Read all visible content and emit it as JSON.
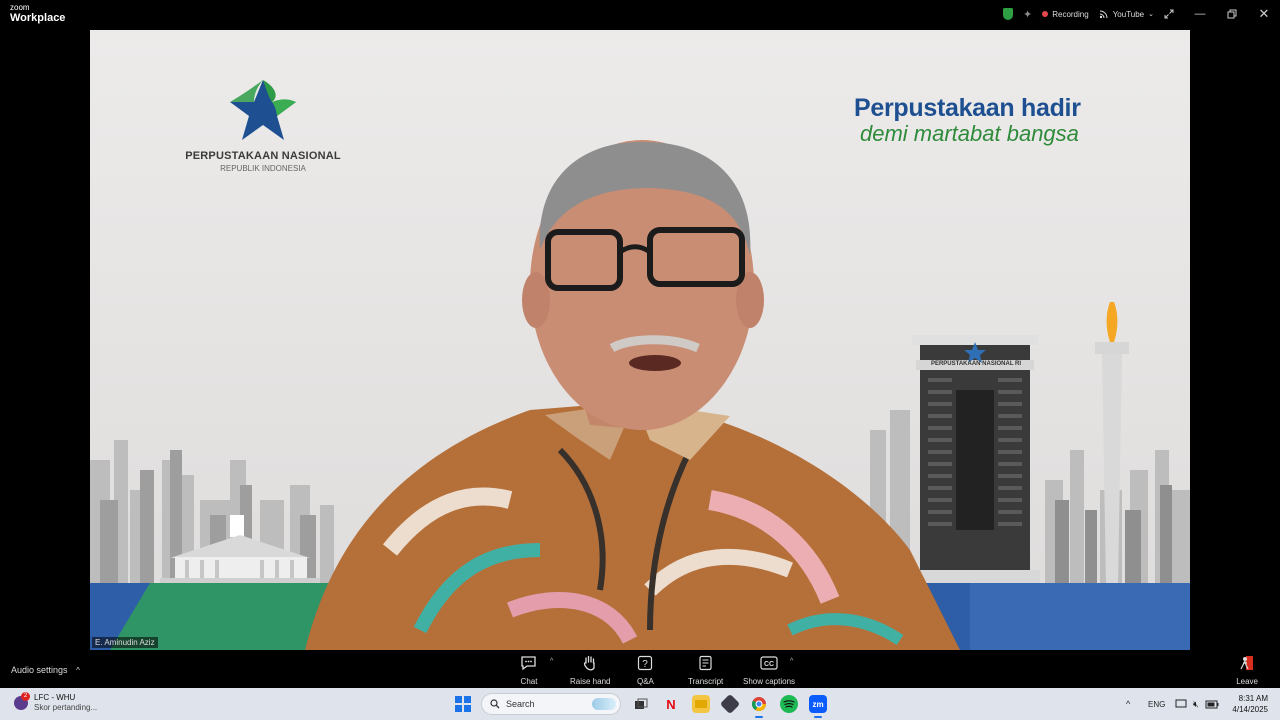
{
  "app": {
    "brand_small": "zoom",
    "brand_big": "Workplace"
  },
  "titlebar": {
    "recording_label": "Recording",
    "stream_label": "YouTube",
    "icons": [
      "shield-icon",
      "sparkle-icon",
      "recording-dot-icon",
      "broadcast-icon",
      "chevron-down-icon",
      "expand-icon",
      "minimize-icon",
      "restore-icon",
      "close-icon"
    ]
  },
  "video": {
    "logo_title": "PERPUSTAKAAN NASIONAL",
    "logo_subtitle": "REPUBLIK INDONESIA",
    "slogan_line1": "Perpustakaan hadir",
    "slogan_line2": "demi martabat bangsa",
    "building_sign": "PERPUSTAKAAN NASIONAL RI",
    "participant_name": "E. Aminudin Aziz"
  },
  "controls": {
    "audio_settings": "Audio settings",
    "chat": "Chat",
    "raise_hand": "Raise hand",
    "qa": "Q&A",
    "transcript": "Transcript",
    "show_captions": "Show captions",
    "leave": "Leave"
  },
  "taskbar": {
    "widget_title": "LFC - WHU",
    "widget_subtitle": "Skor pertanding...",
    "widget_badge": "2",
    "search_placeholder": "Search",
    "language": "ENG",
    "time": "8:31 AM",
    "date": "4/14/2025",
    "apps": [
      "task-view-icon",
      "netflix-icon",
      "file-explorer-icon",
      "app-icon",
      "chrome-icon",
      "spotify-icon",
      "zoom-icon"
    ]
  },
  "colors": {
    "slogan_blue": "#1d4f91",
    "slogan_green": "#2e8b3a",
    "recording_red": "#e5484d",
    "shield_green": "#2ea043",
    "taskbar": "#dfe4ec"
  }
}
